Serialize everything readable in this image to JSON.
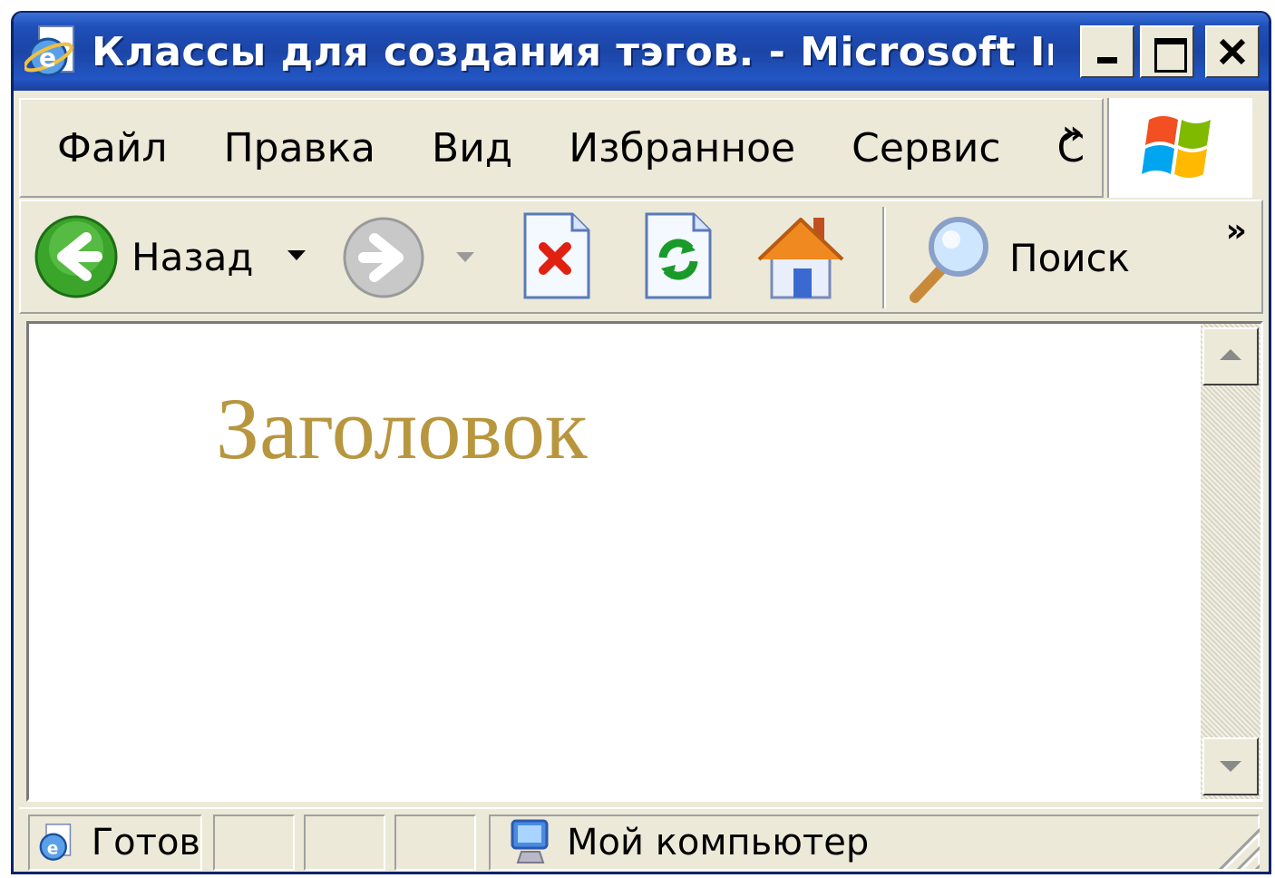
{
  "window": {
    "title": "Классы для создания тэгов. - Microsoft In..."
  },
  "menu": {
    "items": [
      "Файл",
      "Правка",
      "Вид",
      "Избранное",
      "Сервис",
      "С"
    ],
    "overflow": "»"
  },
  "toolbar": {
    "back_label": "Назад",
    "search_label": "Поиск",
    "overflow": "»"
  },
  "content": {
    "heading": "Заголовок",
    "heading_color": "#b8963e"
  },
  "status": {
    "state": "Готов",
    "zone": "Мой компьютер"
  },
  "colors": {
    "titlebar": "#1f4fb9",
    "chrome": "#ece9d8"
  }
}
